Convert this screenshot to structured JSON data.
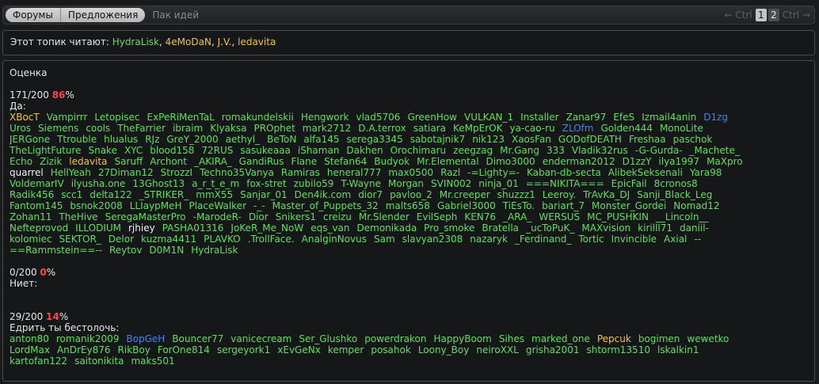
{
  "breadcrumbs": [
    "Форумы",
    "Предложения",
    "Пак идей"
  ],
  "pager": {
    "prev": "← Ctrl",
    "pages": [
      "1",
      "2"
    ],
    "current": "1",
    "next": "Ctrl →"
  },
  "readers": {
    "label": "Этот топик читают:",
    "users": [
      {
        "name": "HydraLisk",
        "color": "green",
        "sep": ", "
      },
      {
        "name": "4eMoDaN",
        "color": "yellow",
        "sep": ", "
      },
      {
        "name": "J.V.",
        "color": "yellow",
        "sep": ", "
      },
      {
        "name": "ledavita",
        "color": "yellow",
        "sep": ""
      }
    ]
  },
  "poll": {
    "title": "Оценка",
    "options": [
      {
        "count": "171/200",
        "percent": "86",
        "label": "Да:",
        "lines": [
          [
            [
              "XBocT",
              "y"
            ],
            [
              "Vampirrr",
              "g"
            ],
            [
              "Letopisec",
              "g"
            ],
            [
              "ExPeRiMenTaL",
              "g"
            ],
            [
              "romakundelskii",
              "g"
            ],
            [
              "Hengwork",
              "g"
            ],
            [
              "vlad5706",
              "g"
            ],
            [
              "GreenHow",
              "g"
            ],
            [
              "VULKAN_1",
              "g"
            ],
            [
              "Installer",
              "g"
            ],
            [
              "Zanar97",
              "g"
            ],
            [
              "EfeS",
              "g"
            ],
            [
              "Izmail4anin",
              "g"
            ],
            [
              "D1zg",
              "b"
            ]
          ],
          [
            [
              "Uros",
              "g"
            ],
            [
              "Siemens",
              "g"
            ],
            [
              "cools",
              "g"
            ],
            [
              "TheFarrier",
              "g"
            ],
            [
              "ibraim",
              "g"
            ],
            [
              "Klyaksa",
              "g"
            ],
            [
              "PROphet",
              "g"
            ],
            [
              "mark2712",
              "g"
            ],
            [
              "D.A.terrox",
              "g"
            ],
            [
              "satiara",
              "g"
            ],
            [
              "KeMpErOK",
              "g"
            ],
            [
              "ya-cao-ru",
              "g"
            ],
            [
              "ZLOfm",
              "b"
            ],
            [
              "Golden444",
              "g"
            ],
            [
              "MonoLite",
              "g"
            ]
          ],
          [
            [
              "JERGone",
              "g"
            ],
            [
              "Ttrouble",
              "g"
            ],
            [
              "hlualus",
              "g"
            ],
            [
              "RJz",
              "g"
            ],
            [
              "GreY_2000",
              "g"
            ],
            [
              "aethyl_",
              "g"
            ],
            [
              "BeToN",
              "g"
            ],
            [
              "alfa145",
              "g"
            ],
            [
              "serega3345",
              "g"
            ],
            [
              "sabotajnik7",
              "g"
            ],
            [
              "nik123",
              "g"
            ],
            [
              "XaosFan",
              "g"
            ],
            [
              "GODofDEATH",
              "g"
            ],
            [
              "Freshaa",
              "g"
            ],
            [
              "paschok",
              "g"
            ]
          ],
          [
            [
              "TheLightFuture",
              "g"
            ],
            [
              "Snake",
              "g"
            ],
            [
              "XYC",
              "g"
            ],
            [
              "blood158",
              "g"
            ],
            [
              "72RUS",
              "g"
            ],
            [
              "sasukeaaa",
              "g"
            ],
            [
              "iShaman",
              "g"
            ],
            [
              "Dakhen",
              "g"
            ],
            [
              "Orochimaru",
              "g"
            ],
            [
              "zeegzag",
              "g"
            ],
            [
              "Mr.Gang",
              "g"
            ],
            [
              "333",
              "g"
            ],
            [
              "Vladik32rus",
              "g"
            ],
            [
              "-G-Gurda-",
              "g"
            ],
            [
              "_Machete_",
              "g"
            ]
          ],
          [
            [
              "Echo",
              "g"
            ],
            [
              "Zizik",
              "g"
            ],
            [
              "ledavita",
              "y"
            ],
            [
              "Saruff",
              "g"
            ],
            [
              "Archont",
              "g"
            ],
            [
              "_AKIRA_",
              "g"
            ],
            [
              "GandiRus",
              "g"
            ],
            [
              "Flane",
              "g"
            ],
            [
              "Stefan64",
              "g"
            ],
            [
              "Budyok",
              "g"
            ],
            [
              "Mr.Elemental",
              "g"
            ],
            [
              "Dimo3000",
              "g"
            ],
            [
              "enderman2012",
              "g"
            ],
            [
              "D1zzY",
              "g"
            ],
            [
              "ilya1997",
              "g"
            ],
            [
              "MaXpro",
              "g"
            ]
          ],
          [
            [
              "quarrel",
              "w"
            ],
            [
              "HellYeah",
              "g"
            ],
            [
              "27Diman12",
              "g"
            ],
            [
              "StrozzI",
              "g"
            ],
            [
              "Techno35Vanya",
              "g"
            ],
            [
              "Ramiras",
              "g"
            ],
            [
              "heneral777",
              "g"
            ],
            [
              "max0500",
              "g"
            ],
            [
              "Razl",
              "g"
            ],
            [
              "-=Lighty=-",
              "g"
            ],
            [
              "Kaban-db-secta",
              "g"
            ],
            [
              "AlibekSeksenali",
              "g"
            ],
            [
              "Yara98",
              "g"
            ]
          ],
          [
            [
              "VoldemarIV",
              "g"
            ],
            [
              "ilyusha.one",
              "g"
            ],
            [
              "13Ghost13",
              "g"
            ],
            [
              "a_r_t_e_m",
              "g"
            ],
            [
              "fox-stret",
              "g"
            ],
            [
              "zubilo59",
              "g"
            ],
            [
              "T-Wayne",
              "g"
            ],
            [
              "Morgan",
              "g"
            ],
            [
              "SVIN002",
              "g"
            ],
            [
              "ninja_01",
              "g"
            ],
            [
              "===NIKITA===",
              "g"
            ],
            [
              "EpicFail",
              "g"
            ],
            [
              "8cronos8",
              "g"
            ]
          ],
          [
            [
              "Radik456",
              "g"
            ],
            [
              "scc1",
              "g"
            ],
            [
              "delta122",
              "g"
            ],
            [
              "_STRIKER_",
              "g"
            ],
            [
              "mmX55",
              "g"
            ],
            [
              "Sanjar_01",
              "g"
            ],
            [
              "Den4ik.com",
              "g"
            ],
            [
              "dior7",
              "g"
            ],
            [
              "pavloo_2",
              "g"
            ],
            [
              "Mr.creeper",
              "g"
            ],
            [
              "shuzzz1",
              "g"
            ],
            [
              "Leeroy.",
              "g"
            ],
            [
              "TrAvKa_DJ",
              "g"
            ],
            [
              "Sanji_Black_Leg",
              "g"
            ]
          ],
          [
            [
              "Fantom145",
              "g"
            ],
            [
              "bsnok2008",
              "g"
            ],
            [
              "LLIaypMeH",
              "g"
            ],
            [
              "PlaceWalker",
              "g"
            ],
            [
              "-_-",
              "g"
            ],
            [
              "Master_of_Puppets_32",
              "g"
            ],
            [
              "malts658",
              "g"
            ],
            [
              "Gabriel3000",
              "g"
            ],
            [
              "TiEsTo.",
              "g"
            ],
            [
              "bariart_7",
              "g"
            ],
            [
              "Monster_Gordei",
              "g"
            ],
            [
              "Nomad12",
              "g"
            ]
          ],
          [
            [
              "Zohan11",
              "g"
            ],
            [
              "TheHive",
              "g"
            ],
            [
              "SeregaMasterPro",
              "g"
            ],
            [
              "-MarodeR-",
              "g"
            ],
            [
              "Dior",
              "g"
            ],
            [
              "Snikers1",
              "g"
            ],
            [
              "creizu",
              "g"
            ],
            [
              "Mr.Slender",
              "g"
            ],
            [
              "EvilSeph",
              "g"
            ],
            [
              "KEN76",
              "g"
            ],
            [
              "_ARA_",
              "g"
            ],
            [
              "WERSUS",
              "g"
            ],
            [
              "MC_PUSHKIN",
              "g"
            ],
            [
              "__Lincoln__",
              "g"
            ]
          ],
          [
            [
              "Nefteprovod",
              "g"
            ],
            [
              "ILLODIUM",
              "g"
            ],
            [
              "rjhiey",
              "w"
            ],
            [
              "PASHA01316",
              "g"
            ],
            [
              "JoKeR_Me_NoW",
              "g"
            ],
            [
              "eqs_van",
              "g"
            ],
            [
              "Demonikada",
              "g"
            ],
            [
              "Pro_smoke",
              "g"
            ],
            [
              "Bratella",
              "g"
            ],
            [
              "_ucToPuK_",
              "g"
            ],
            [
              "MAXvision",
              "g"
            ],
            [
              "kirilll71",
              "g"
            ],
            [
              "daniil-",
              "g"
            ]
          ],
          [
            [
              "kolomiec",
              "g"
            ],
            [
              "SEKTOR_",
              "g"
            ],
            [
              "Delor",
              "g"
            ],
            [
              "kuzma4411",
              "g"
            ],
            [
              "PLAVKO",
              "g"
            ],
            [
              ".TrollFace.",
              "g"
            ],
            [
              "AnalginNovus",
              "g"
            ],
            [
              "Sam",
              "g"
            ],
            [
              "slavyan2308",
              "g"
            ],
            [
              "nazaryk",
              "g"
            ],
            [
              "_Ferdinand_",
              "g"
            ],
            [
              "Tortic",
              "g"
            ],
            [
              "Invincible",
              "g"
            ],
            [
              "Axial",
              "g"
            ],
            [
              "--",
              "g"
            ]
          ],
          [
            [
              "==Rammstein==--",
              "g"
            ],
            [
              "Reytov",
              "g"
            ],
            [
              "D0M1N",
              "g"
            ],
            [
              "HydraLisk",
              "g"
            ]
          ]
        ]
      },
      {
        "count": "0/200",
        "percent": "0",
        "label": "Ниет:",
        "lines": []
      },
      {
        "count": "29/200",
        "percent": "14",
        "label": "Едрить ты бестолочь:",
        "lines": [
          [
            [
              "anton80",
              "g"
            ],
            [
              "romanik2009",
              "g"
            ],
            [
              "BopGeH",
              "b"
            ],
            [
              "Bouncer77",
              "g"
            ],
            [
              "vanicecream",
              "g"
            ],
            [
              "Ser_Glushko",
              "g"
            ],
            [
              "powerdrakon",
              "g"
            ],
            [
              "HappyBoom",
              "g"
            ],
            [
              "Sihes",
              "g"
            ],
            [
              "marked_one",
              "g"
            ],
            [
              "Pepcuk",
              "y"
            ],
            [
              "bogimen",
              "g"
            ],
            [
              "wewetko",
              "g"
            ]
          ],
          [
            [
              "LordMax",
              "g"
            ],
            [
              "AnDrEy876",
              "g"
            ],
            [
              "RikBoy",
              "g"
            ],
            [
              "ForOne814",
              "g"
            ],
            [
              "sergeyork1",
              "g"
            ],
            [
              "xEvGeNx",
              "g"
            ],
            [
              "kemper",
              "g"
            ],
            [
              "posahok",
              "g"
            ],
            [
              "Loony_Boy",
              "g"
            ],
            [
              "neiroXXL",
              "g"
            ],
            [
              "grisha2001",
              "g"
            ],
            [
              "shtorm13510",
              "g"
            ],
            [
              "lskalkin1",
              "g"
            ]
          ],
          [
            [
              "kartofan122",
              "g"
            ],
            [
              "saitonikita",
              "g"
            ],
            [
              "maks501",
              "g"
            ]
          ]
        ]
      }
    ]
  }
}
